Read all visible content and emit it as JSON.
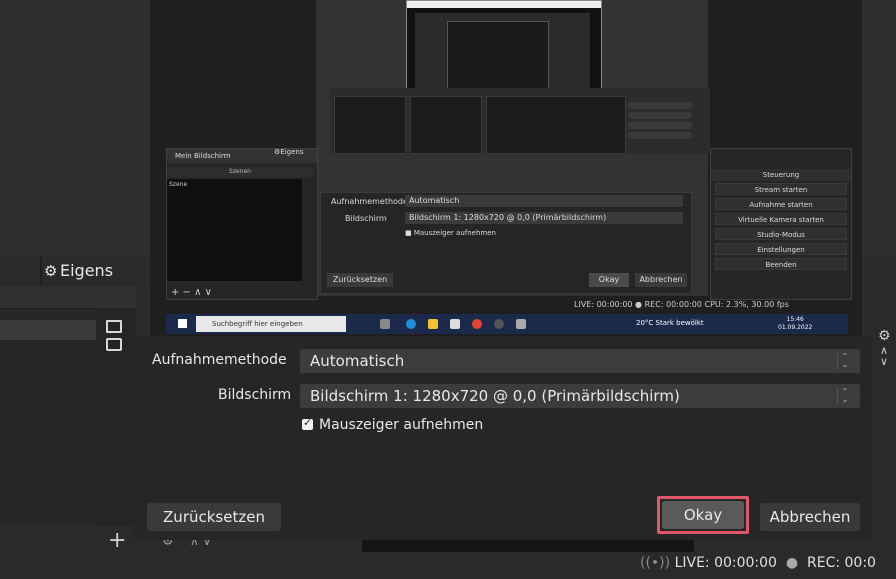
{
  "background_window": {
    "properties_tab_label": "Eigens",
    "status_live": "LIVE: 00:00:00",
    "status_rec": "REC: 00:0"
  },
  "preview": {
    "mini_window_title": "Mein Bildschirm",
    "mini_properties_label": "Eigens",
    "mini_scenes_header": "Szenen",
    "mini_scene_item": "Szene",
    "mini_footer_controls": "+ − ∧ ∨",
    "mini_dialog": {
      "capture_method_label": "Aufnahmemethode",
      "capture_method_value": "Automatisch",
      "display_label": "Bildschirm",
      "display_value": "Bildschirm 1: 1280x720 @ 0,0 (Primärbildschirm)",
      "cursor_checkbox_label": "Mauszeiger aufnehmen",
      "reset_label": "Zurücksetzen",
      "okay_label": "Okay",
      "cancel_label": "Abbrechen"
    },
    "controls_header": "Steuerung",
    "controls_buttons": [
      "Stream starten",
      "Aufnahme starten",
      "Virtuelle Kamera starten",
      "Studio-Modus",
      "Einstellungen",
      "Beenden"
    ],
    "status_text": "LIVE: 00:00:00  ●  REC: 00:00:00    CPU: 2.3%, 30.00 fps",
    "taskbar": {
      "search_placeholder": "Suchbegriff hier eingeben",
      "weather": "20°C  Stark bewölkt",
      "time": "15:46",
      "date": "01.09.2022"
    }
  },
  "dialog": {
    "capture_method_label": "Aufnahmemethode",
    "capture_method_value": "Automatisch",
    "display_label": "Bildschirm",
    "display_value": "Bildschirm 1: 1280x720 @ 0,0 (Primärbildschirm)",
    "cursor_checkbox_label": "Mauszeiger aufnehmen",
    "cursor_checkbox_checked": true,
    "reset_button": "Zurücksetzen",
    "okay_button": "Okay",
    "cancel_button": "Abbrechen"
  },
  "colors": {
    "highlight": "#e1576a",
    "dialog_bg": "#262626",
    "field_bg": "#3c3c3c"
  }
}
